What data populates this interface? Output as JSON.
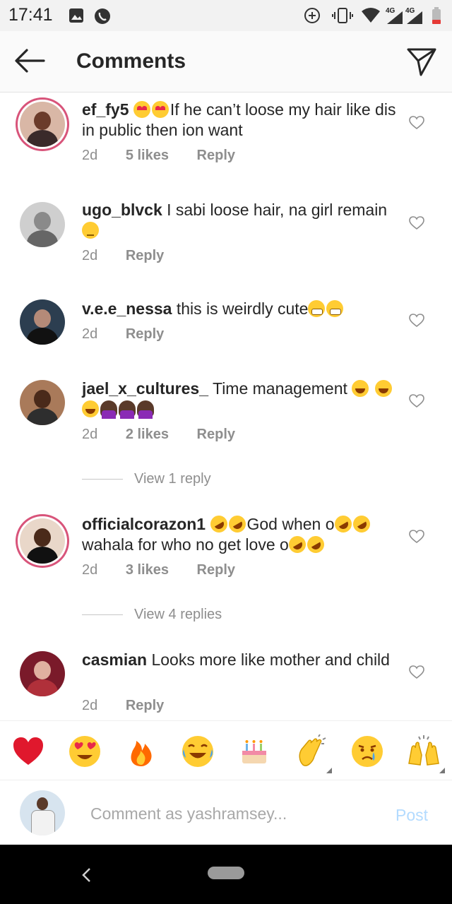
{
  "status_bar": {
    "time": "17:41",
    "network_label_1": "4G",
    "network_label_2": "4G"
  },
  "header": {
    "title": "Comments"
  },
  "comments": [
    {
      "username": "ef_fy5",
      "text_before": "",
      "text_after": "If he can’t loose my hair like dis in public then ion want",
      "time": "2d",
      "likes": "5 likes",
      "reply": "Reply"
    },
    {
      "username": "ugo_blvck",
      "text_before": "I sabi loose hair, na girl remain",
      "time": "2d",
      "reply": "Reply"
    },
    {
      "username": "v.e.e_nessa",
      "text_before": "this is weirdly cute",
      "time": "2d",
      "reply": "Reply"
    },
    {
      "username": "jael_x_cultures_",
      "text_before": "Time management",
      "time": "2d",
      "likes": "2 likes",
      "reply": "Reply",
      "view_replies": "View 1 reply"
    },
    {
      "username": "officialcorazon1",
      "text_before": "God when o",
      "text_after": "wahala for who no get love o",
      "time": "2d",
      "likes": "3 likes",
      "reply": "Reply",
      "view_replies": "View 4 replies"
    },
    {
      "username": "casmian",
      "text_before": "Looks more like mother and child",
      "time": "2d",
      "reply": "Reply"
    }
  ],
  "reactions": [
    "red-heart",
    "heart-eyes",
    "fire",
    "joy",
    "birthday-cake",
    "clapping-hands",
    "crying-face",
    "raising-hands"
  ],
  "composer": {
    "placeholder": "Comment as yashramsey...",
    "post_label": "Post"
  },
  "colors": {
    "accent_link": "#b3dbff",
    "story_ring": "#d8547a",
    "muted": "#8e8e8e"
  }
}
